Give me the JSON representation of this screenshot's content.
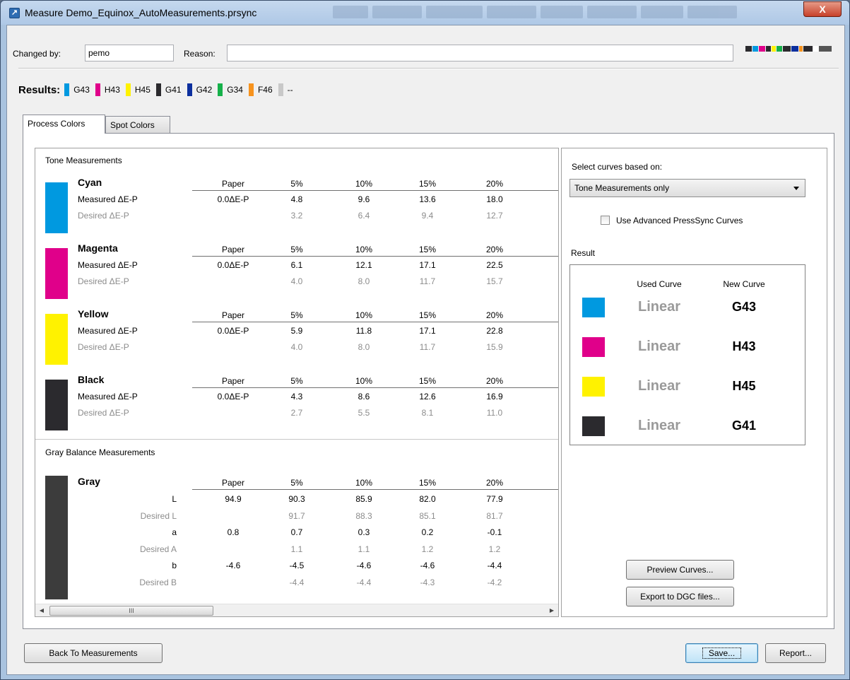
{
  "window": {
    "title": "Measure Demo_Equinox_AutoMeasurements.prsync",
    "close_label": "X"
  },
  "form": {
    "changed_by_label": "Changed by:",
    "changed_by_value": "pemo",
    "reason_label": "Reason:",
    "reason_value": ""
  },
  "results": {
    "label": "Results:",
    "items": [
      {
        "label": "G43",
        "color": "#0099e0"
      },
      {
        "label": "H43",
        "color": "#e0008a"
      },
      {
        "label": "H45",
        "color": "#fff200"
      },
      {
        "label": "G41",
        "color": "#2b2a2e"
      },
      {
        "label": "G42",
        "color": "#0c2f9e"
      },
      {
        "label": "G34",
        "color": "#16b14a"
      },
      {
        "label": "F46",
        "color": "#f7931e"
      },
      {
        "label": "--",
        "color": "#c8c8c8"
      }
    ]
  },
  "tabs": [
    "Process Colors",
    "Spot Colors"
  ],
  "tone": {
    "title": "Tone Measurements",
    "columns": [
      "Paper",
      "5%",
      "10%",
      "15%",
      "20%"
    ],
    "colors": [
      {
        "name": "Cyan",
        "swatch": "#0099e0",
        "measured_label": "Measured ΔE-P",
        "desired_label": "Desired ΔE-P",
        "measured": [
          "0.0ΔE-P",
          "4.8",
          "9.6",
          "13.6",
          "18.0"
        ],
        "desired": [
          "",
          "3.2",
          "6.4",
          "9.4",
          "12.7"
        ]
      },
      {
        "name": "Magenta",
        "swatch": "#e0008a",
        "measured_label": "Measured ΔE-P",
        "desired_label": "Desired ΔE-P",
        "measured": [
          "0.0ΔE-P",
          "6.1",
          "12.1",
          "17.1",
          "22.5"
        ],
        "desired": [
          "",
          "4.0",
          "8.0",
          "11.7",
          "15.7"
        ]
      },
      {
        "name": "Yellow",
        "swatch": "#fff200",
        "measured_label": "Measured ΔE-P",
        "desired_label": "Desired ΔE-P",
        "measured": [
          "0.0ΔE-P",
          "5.9",
          "11.8",
          "17.1",
          "22.8"
        ],
        "desired": [
          "",
          "4.0",
          "8.0",
          "11.7",
          "15.9"
        ]
      },
      {
        "name": "Black",
        "swatch": "#2b2a2e",
        "measured_label": "Measured ΔE-P",
        "desired_label": "Desired ΔE-P",
        "measured": [
          "0.0ΔE-P",
          "4.3",
          "8.6",
          "12.6",
          "16.9"
        ],
        "desired": [
          "",
          "2.7",
          "5.5",
          "8.1",
          "11.0"
        ]
      }
    ]
  },
  "gray": {
    "title": "Gray Balance Measurements",
    "name": "Gray",
    "swatch": "#3c3c3c",
    "columns": [
      "Paper",
      "5%",
      "10%",
      "15%",
      "20%"
    ],
    "rows": [
      {
        "label": "L",
        "muted": false,
        "values": [
          "94.9",
          "90.3",
          "85.9",
          "82.0",
          "77.9"
        ]
      },
      {
        "label": "Desired L",
        "muted": true,
        "values": [
          "",
          "91.7",
          "88.3",
          "85.1",
          "81.7"
        ]
      },
      {
        "label": "a",
        "muted": false,
        "values": [
          "0.8",
          "0.7",
          "0.3",
          "0.2",
          "-0.1"
        ]
      },
      {
        "label": "Desired A",
        "muted": true,
        "values": [
          "",
          "1.1",
          "1.1",
          "1.2",
          "1.2"
        ]
      },
      {
        "label": "b",
        "muted": false,
        "values": [
          "-4.6",
          "-4.5",
          "-4.6",
          "-4.6",
          "-4.4"
        ]
      },
      {
        "label": "Desired B",
        "muted": true,
        "values": [
          "",
          "-4.4",
          "-4.4",
          "-4.3",
          "-4.2"
        ]
      }
    ]
  },
  "scrollbar": {
    "thumb_label": "III"
  },
  "right": {
    "select_label": "Select curves based on:",
    "select_value": "Tone Measurements only",
    "checkbox_label": "Use Advanced PressSync Curves",
    "checkbox_checked": false,
    "result_label": "Result",
    "used_header": "Used Curve",
    "new_header": "New Curve",
    "rows": [
      {
        "swatch": "#0099e0",
        "used": "Linear",
        "new": "G43"
      },
      {
        "swatch": "#e0008a",
        "used": "Linear",
        "new": "H43"
      },
      {
        "swatch": "#fff200",
        "used": "Linear",
        "new": "H45"
      },
      {
        "swatch": "#2b2a2e",
        "used": "Linear",
        "new": "G41"
      }
    ],
    "preview_button": "Preview Curves...",
    "export_button": "Export to DGC files..."
  },
  "footer": {
    "back_button": "Back To Measurements",
    "save_button": "Save...",
    "report_button": "Report..."
  }
}
